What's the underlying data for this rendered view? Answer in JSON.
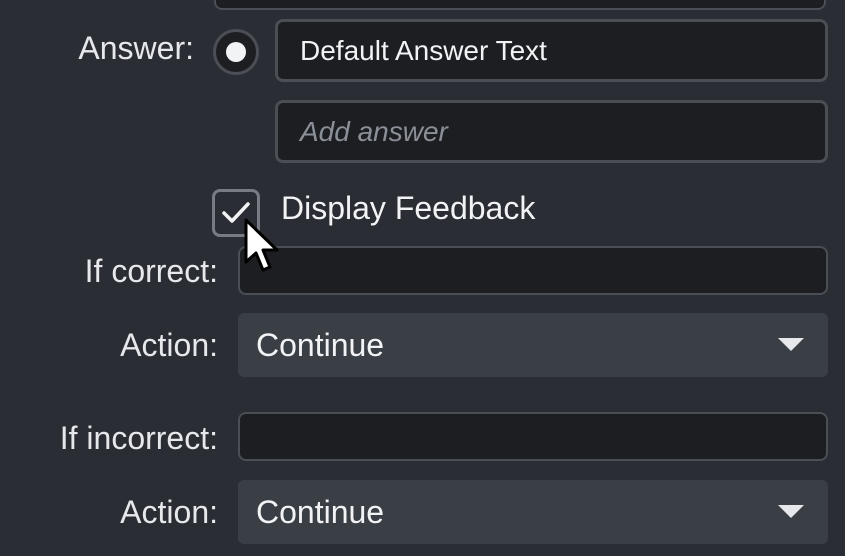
{
  "answer_section": {
    "label": "Answer:",
    "answer_value": "Default Answer Text",
    "add_answer_placeholder": "Add answer"
  },
  "feedback": {
    "checkbox_label": "Display Feedback",
    "checked": true,
    "if_correct_label": "If correct:",
    "if_correct_value": "",
    "correct_action_label": "Action:",
    "correct_action_value": "Continue",
    "if_incorrect_label": "If incorrect:",
    "if_incorrect_value": "",
    "incorrect_action_label": "Action:",
    "incorrect_action_value": "Continue"
  },
  "icons": {
    "radio": "radio-selected-icon",
    "check": "checkmark-icon",
    "caret": "chevron-down-icon",
    "cursor": "mouse-pointer-icon"
  },
  "colors": {
    "panel_bg": "#2a2d33",
    "field_bg": "#1c1e22",
    "field_border": "#4a4e55",
    "select_bg": "#3a3e45",
    "text": "#f2f3f5",
    "placeholder": "#8b9098"
  }
}
